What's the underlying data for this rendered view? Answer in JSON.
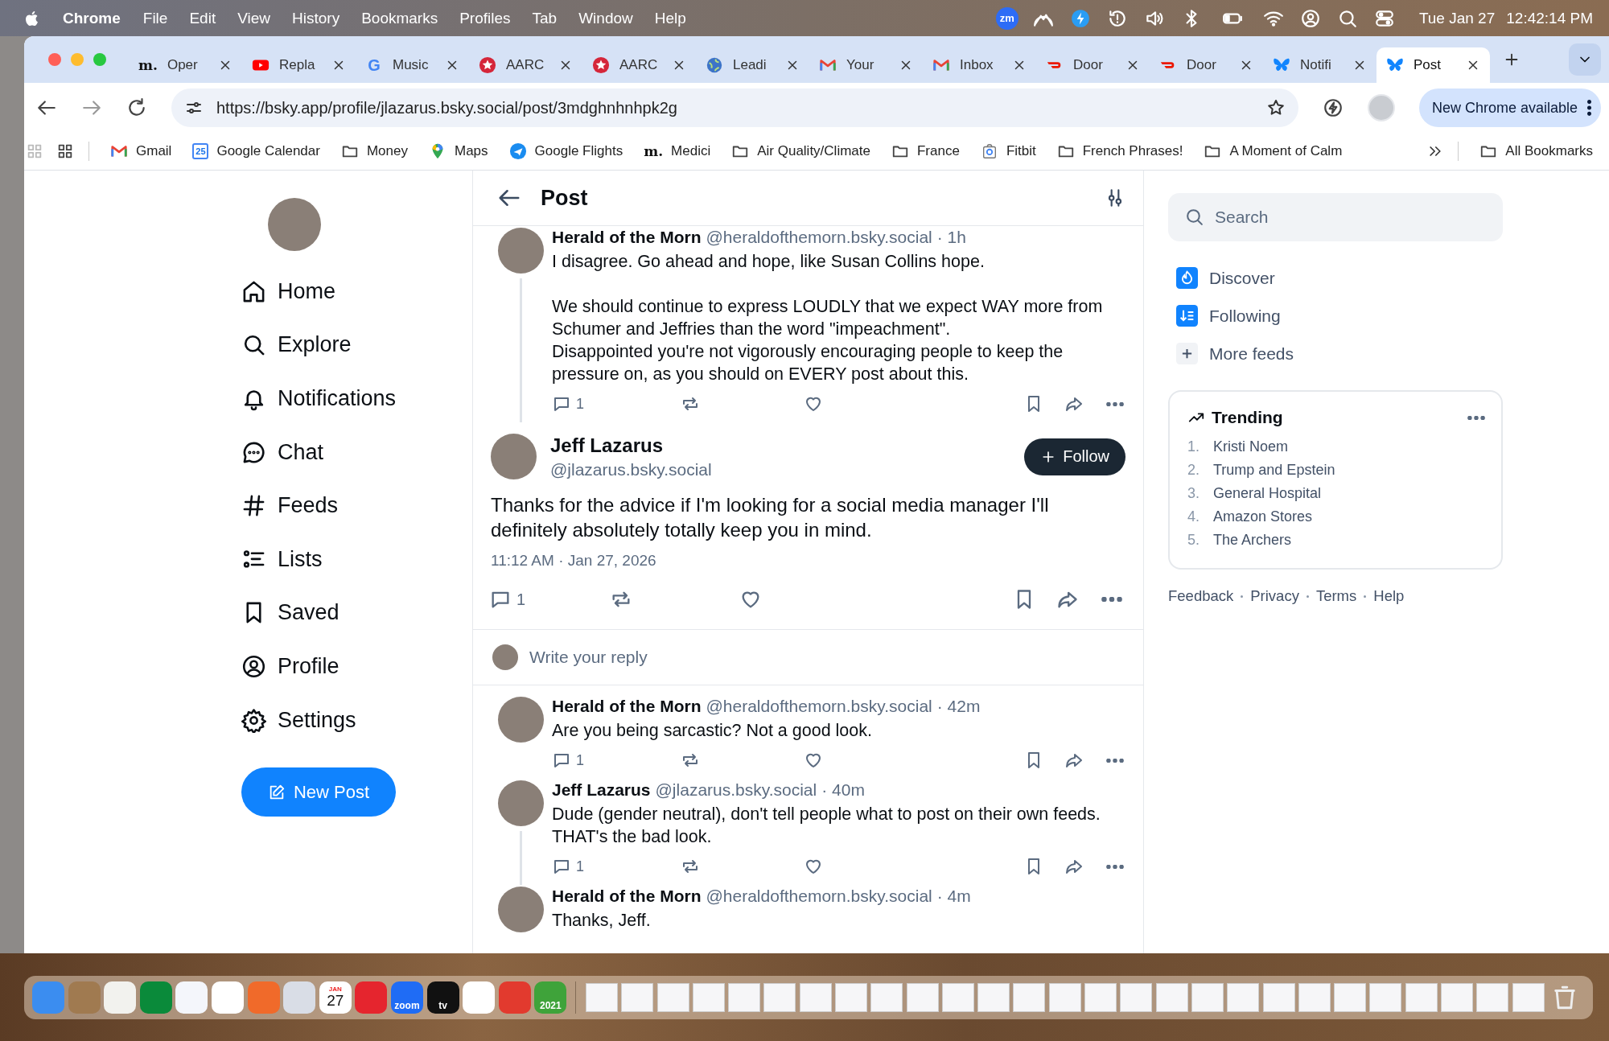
{
  "menu_bar": {
    "app": "Chrome",
    "menus": [
      "File",
      "Edit",
      "View",
      "History",
      "Bookmarks",
      "Profiles",
      "Tab",
      "Window",
      "Help"
    ],
    "status_icons": [
      {
        "kind": "zoom",
        "text": "zm"
      },
      {
        "kind": "mountain"
      },
      {
        "kind": "bolt"
      },
      {
        "kind": "history"
      },
      {
        "kind": "volume"
      },
      {
        "kind": "bluetooth"
      },
      {
        "kind": "battery"
      },
      {
        "kind": "wifi"
      },
      {
        "kind": "user"
      },
      {
        "kind": "search"
      },
      {
        "kind": "control"
      }
    ],
    "date": "Tue Jan 27",
    "time": "12:42:14 PM"
  },
  "tabs": [
    {
      "kind": "medici",
      "icon_text": "m.",
      "label": "Oper",
      "selected": false
    },
    {
      "kind": "video",
      "label": "Repla",
      "selected": false
    },
    {
      "kind": "google",
      "icon_text": "G",
      "label": "Music",
      "selected": false
    },
    {
      "kind": "star",
      "label": "AARC",
      "selected": false
    },
    {
      "kind": "star",
      "label": "AARC",
      "selected": false
    },
    {
      "kind": "globe",
      "label": "Leadi",
      "selected": false
    },
    {
      "kind": "mail",
      "label": "Your",
      "selected": false
    },
    {
      "kind": "mail",
      "label": "Inbox",
      "selected": false
    },
    {
      "kind": "dash",
      "label": "Door",
      "selected": false
    },
    {
      "kind": "dash",
      "label": "Door",
      "selected": false
    },
    {
      "kind": "butterfly",
      "label": "Notifi",
      "selected": false
    },
    {
      "kind": "butterfly",
      "label": "Post",
      "selected": true
    }
  ],
  "address_bar": {
    "url": "https://bsky.app/profile/jlazarus.bsky.social/post/3mdghnhnhpk2g",
    "update_button": "New Chrome available"
  },
  "bookmarks": [
    {
      "kind": "mail",
      "label": "Gmail"
    },
    {
      "kind": "calendar",
      "icon_text": "25",
      "label": "Google Calendar"
    },
    {
      "kind": "folder",
      "label": "Money"
    },
    {
      "kind": "pin",
      "label": "Maps"
    },
    {
      "kind": "plane",
      "label": "Google Flights"
    },
    {
      "kind": "medici",
      "icon_text": "m.",
      "label": "Medici"
    },
    {
      "kind": "folder",
      "label": "Air Quality/Climate"
    },
    {
      "kind": "folder",
      "label": "France"
    },
    {
      "kind": "fitbit",
      "label": "Fitbit"
    },
    {
      "kind": "folder",
      "label": "French Phrases!"
    },
    {
      "kind": "folder",
      "label": "A Moment of Calm"
    }
  ],
  "all_bookmarks": "All Bookmarks",
  "sidebar": {
    "items": [
      {
        "kind": "home",
        "label": "Home"
      },
      {
        "kind": "search",
        "label": "Explore"
      },
      {
        "kind": "bell",
        "label": "Notifications"
      },
      {
        "kind": "chat",
        "label": "Chat"
      },
      {
        "kind": "hash",
        "label": "Feeds"
      },
      {
        "kind": "lists",
        "label": "Lists"
      },
      {
        "kind": "bookmark",
        "label": "Saved"
      },
      {
        "kind": "profile",
        "label": "Profile"
      },
      {
        "kind": "gear",
        "label": "Settings"
      }
    ],
    "new_post": "New Post"
  },
  "post_view": {
    "title": "Post",
    "thread": [
      {
        "name": "Herald of the Morn",
        "handle": "@heraldofthemorn.bsky.social",
        "time": "· 1h",
        "text": "I disagree. Go ahead and hope, like Susan Collins hope.\n\nWe should continue to express LOUDLY that we expect WAY more from Schumer and Jeffries than the word \"impeachment\".\nDisappointed you're not vigorously encouraging people to keep the pressure on, as you should on EVERY post about this.",
        "reply_count": "1",
        "thread_line": true
      }
    ],
    "focus": {
      "name": "Jeff Lazarus",
      "handle": "@jlazarus.bsky.social",
      "follow": "Follow",
      "text": "Thanks for the advice if I'm looking for a social media manager I'll definitely absolutely totally keep you in mind.",
      "date": "11:12 AM · Jan 27, 2026",
      "reply_count": "1"
    },
    "reply_box": {
      "placeholder": "Write your reply"
    },
    "replies": [
      {
        "name": "Herald of the Morn",
        "handle": "@heraldofthemorn.bsky.social",
        "time": "· 42m",
        "text": "Are you being sarcastic? Not a good look.",
        "reply_count": "1",
        "thread_line": false
      },
      {
        "name": "Jeff Lazarus",
        "handle": "@jlazarus.bsky.social",
        "time": "· 40m",
        "text": "Dude (gender neutral), don't tell people what to post on their own feeds.\nTHAT's the bad look.",
        "reply_count": "1",
        "thread_line": true
      },
      {
        "name": "Herald of the Morn",
        "handle": "@heraldofthemorn.bsky.social",
        "time": "· 4m",
        "text": "Thanks, Jeff.",
        "thread_line": false
      }
    ]
  },
  "right_panel": {
    "search": {
      "placeholder": "Search"
    },
    "feeds": [
      {
        "kind": "flame",
        "label": "Discover"
      },
      {
        "kind": "sort",
        "label": "Following"
      },
      {
        "kind": "plus",
        "label": "More feeds"
      }
    ],
    "trending": {
      "title": "Trending",
      "items": [
        {
          "rank": "1.",
          "label": "Kristi Noem"
        },
        {
          "rank": "2.",
          "label": "Trump and Epstein"
        },
        {
          "rank": "3.",
          "label": "General Hospital"
        },
        {
          "rank": "4.",
          "label": "Amazon Stores"
        },
        {
          "rank": "5.",
          "label": "The Archers"
        }
      ]
    },
    "footer": [
      "Feedback",
      "Privacy",
      "Terms",
      "Help"
    ]
  },
  "dock": {
    "apps": [
      {
        "kind": "tile",
        "color": "#3b8df0"
      },
      {
        "kind": "tile",
        "color": "#a07a50"
      },
      {
        "kind": "tile",
        "color": "#f2f2ee"
      },
      {
        "kind": "tile",
        "color": "#0a8a3a"
      },
      {
        "kind": "tile",
        "color": "#f4f6fb"
      },
      {
        "kind": "tile",
        "color": "#ffffff"
      },
      {
        "kind": "tile",
        "color": "#f06a2a"
      },
      {
        "kind": "tile",
        "color": "#d9dde6"
      },
      {
        "kind": "calendar",
        "color": "#ffffff",
        "month": "JAN",
        "day": "27"
      },
      {
        "kind": "tile",
        "color": "#e5252e"
      },
      {
        "kind": "tile",
        "color": "#1f6cf5",
        "text": "zoom"
      },
      {
        "kind": "tile",
        "color": "#111111",
        "text": "tv"
      },
      {
        "kind": "tile",
        "color": "#ffffff"
      },
      {
        "kind": "tile",
        "color": "#e23a2e"
      },
      {
        "kind": "tile",
        "color": "#3fa33a",
        "text": "2021"
      }
    ]
  }
}
